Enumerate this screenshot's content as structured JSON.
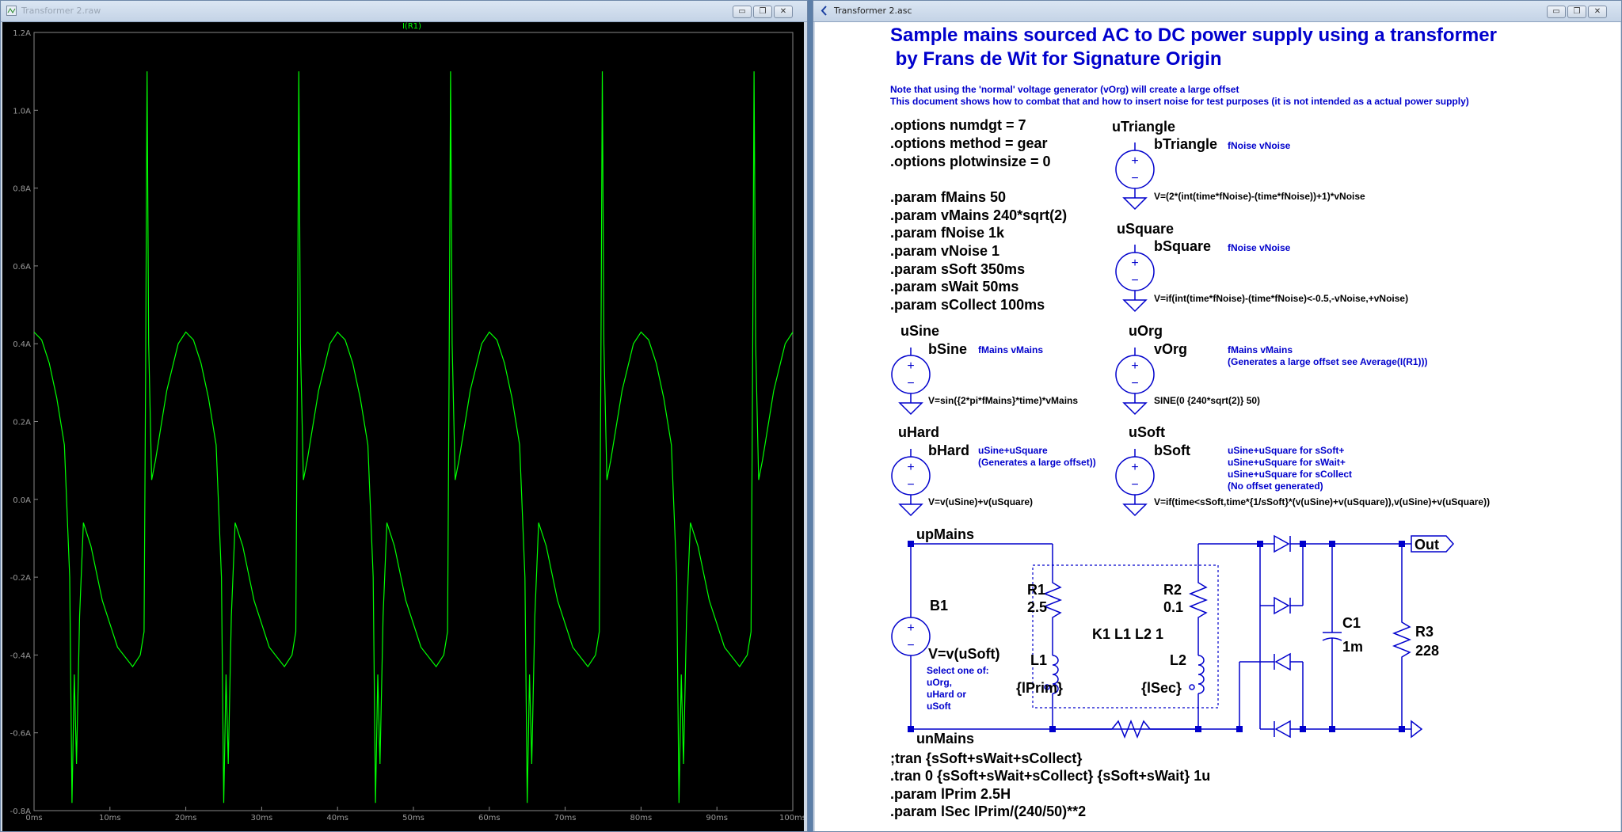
{
  "waveform_window": {
    "title": "Transformer 2.raw",
    "trace_label": "I(R1)",
    "trace_color": "#00ff00",
    "background": "#000000",
    "y_ticks": [
      "1.2A",
      "1.0A",
      "0.8A",
      "0.6A",
      "0.4A",
      "0.2A",
      "0.0A",
      "-0.2A",
      "-0.4A",
      "-0.6A",
      "-0.8A"
    ],
    "x_ticks": [
      "0ms",
      "10ms",
      "20ms",
      "30ms",
      "40ms",
      "50ms",
      "60ms",
      "70ms",
      "80ms",
      "90ms",
      "100ms"
    ],
    "controls": {
      "minimize": "▭",
      "restore": "❐",
      "close": "✕"
    }
  },
  "chart_data": {
    "type": "line",
    "title": "",
    "series": [
      {
        "name": "I(R1)",
        "color": "#00ff00"
      }
    ],
    "xlabel": "",
    "ylabel": "",
    "xlim_ms": [
      0,
      100
    ],
    "ylim_A": [
      -0.8,
      1.2
    ],
    "grid": false,
    "period_ms": 20,
    "shape_points": [
      {
        "t_ms": 0,
        "i_A": 0.43
      },
      {
        "t_ms": 1,
        "i_A": 0.41
      },
      {
        "t_ms": 2,
        "i_A": 0.35
      },
      {
        "t_ms": 3,
        "i_A": 0.26
      },
      {
        "t_ms": 4,
        "i_A": 0.14
      },
      {
        "t_ms": 4.7,
        "i_A": -0.2
      },
      {
        "t_ms": 5,
        "i_A": -0.78
      },
      {
        "t_ms": 5.3,
        "i_A": -0.45
      },
      {
        "t_ms": 5.6,
        "i_A": -0.68
      },
      {
        "t_ms": 6,
        "i_A": -0.3
      },
      {
        "t_ms": 6.5,
        "i_A": -0.06
      },
      {
        "t_ms": 7.5,
        "i_A": -0.12
      },
      {
        "t_ms": 9,
        "i_A": -0.26
      },
      {
        "t_ms": 11,
        "i_A": -0.38
      },
      {
        "t_ms": 13,
        "i_A": -0.43
      },
      {
        "t_ms": 14,
        "i_A": -0.4
      },
      {
        "t_ms": 14.5,
        "i_A": -0.34
      },
      {
        "t_ms": 14.7,
        "i_A": 0.3
      },
      {
        "t_ms": 14.9,
        "i_A": 1.1
      },
      {
        "t_ms": 15.1,
        "i_A": 0.4
      },
      {
        "t_ms": 15.5,
        "i_A": 0.05
      },
      {
        "t_ms": 16,
        "i_A": 0.1
      },
      {
        "t_ms": 17.5,
        "i_A": 0.28
      },
      {
        "t_ms": 19,
        "i_A": 0.4
      },
      {
        "t_ms": 20,
        "i_A": 0.43
      }
    ]
  },
  "schematic_window": {
    "title": "Transformer 2.asc",
    "heading1": "Sample mains sourced AC to DC power supply using a transformer",
    "heading2": " by Frans de Wit for Signature Origin",
    "note1": "Note that using the 'normal' voltage generator (vOrg) will create a large offset",
    "note2": "This document shows how to combat that and how to insert noise for test purposes (it is not intended as a actual power supply)",
    "options": [
      ".options numdgt = 7",
      ".options method = gear",
      ".options plotwinsize = 0"
    ],
    "params": [
      ".param fMains 50",
      ".param vMains 240*sqrt(2)",
      ".param fNoise 1k",
      ".param vNoise 1",
      ".param sSoft 350ms",
      ".param sWait 50ms",
      ".param sCollect 100ms"
    ],
    "sources": {
      "triangle": {
        "net": "uTriangle",
        "name": "bTriangle",
        "attr": "fNoise vNoise",
        "value": "V=(2*(int(time*fNoise)-(time*fNoise))+1)*vNoise"
      },
      "square": {
        "net": "uSquare",
        "name": "bSquare",
        "attr": "fNoise vNoise",
        "value": "V=if(int(time*fNoise)-(time*fNoise)<-0.5,-vNoise,+vNoise)"
      },
      "sine": {
        "net": "uSine",
        "name": "bSine",
        "attr": "fMains vMains",
        "value": "V=sin({2*pi*fMains}*time)*vMains"
      },
      "org": {
        "net": "uOrg",
        "name": "vOrg",
        "attr1": "fMains vMains",
        "attr2": "(Generates a large offset see Average(I(R1)))",
        "value": "SINE(0 {240*sqrt(2)} 50)"
      },
      "hard": {
        "net": "uHard",
        "name": "bHard",
        "attr1": "uSine+uSquare",
        "attr2": "(Generates a large offset))",
        "value": "V=v(uSine)+v(uSquare)"
      },
      "soft": {
        "net": "uSoft",
        "name": "bSoft",
        "attr1": "uSine+uSquare for sSoft+",
        "attr2": "uSine+uSquare for sWait+",
        "attr3": "uSine+uSquare for sCollect",
        "attr4": "(No offset generated)",
        "value": "V=if(time<sSoft,time*{1/sSoft}*(v(uSine)+v(uSquare)),v(uSine)+v(uSquare))"
      }
    },
    "circuit": {
      "up_net": "upMains",
      "down_net": "unMains",
      "b1_name": "B1",
      "b1_value": "V=v(uSoft)",
      "b1_hint": [
        "Select one of:",
        "uOrg,",
        "uHard or",
        "uSoft"
      ],
      "r1_name": "R1",
      "r1_value": "2.5",
      "r2_name": "R2",
      "r2_value": "0.1",
      "coupling": "K1 L1 L2 1",
      "l1_name": "L1",
      "l1_value": "{lPrim}",
      "l2_name": "L2",
      "l2_value": "{lSec}",
      "c1_name": "C1",
      "c1_value": "1m",
      "r3_name": "R3",
      "r3_value": "228",
      "out_label": "Out"
    },
    "directives": [
      ";tran {sSoft+sWait+sCollect}",
      ".tran 0 {sSoft+sWait+sCollect} {sSoft+sWait} 1u",
      ".param lPrim 2.5H",
      ".param lSec lPrim/(240/50)**2"
    ],
    "text_color": "#0000cc",
    "wire_color": "#0000cc",
    "controls": {
      "minimize": "▭",
      "restore": "❐",
      "close": "✕"
    }
  }
}
